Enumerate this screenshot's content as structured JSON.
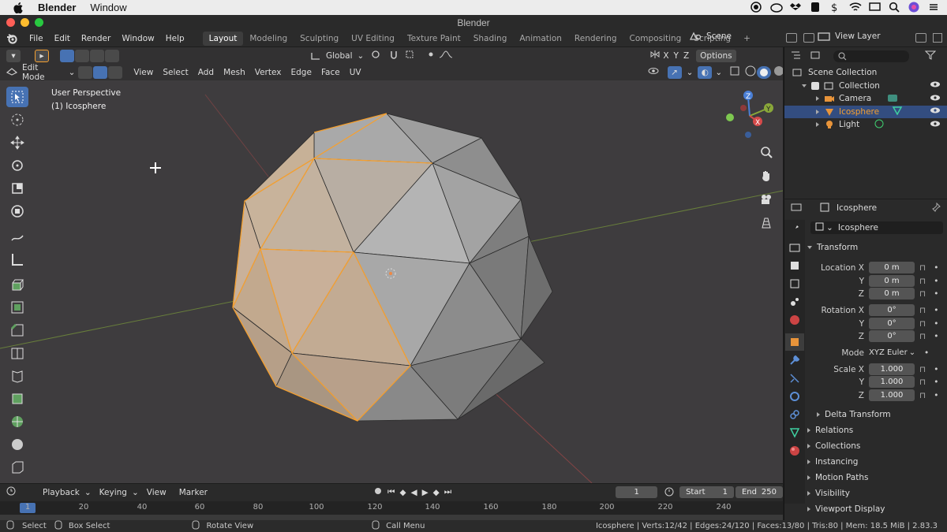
{
  "macbar": {
    "app_name": "Blender",
    "menu_window": "Window"
  },
  "window_title": "Blender",
  "topbar": {
    "menu": [
      "File",
      "Edit",
      "Render",
      "Window",
      "Help"
    ],
    "workspaces": [
      "Layout",
      "Modeling",
      "Sculpting",
      "UV Editing",
      "Texture Paint",
      "Shading",
      "Animation",
      "Rendering",
      "Compositing",
      "Scripting"
    ],
    "active_workspace": "Layout",
    "add_tab": "+",
    "scene": "Scene",
    "view_layer": "View Layer"
  },
  "viewport_header": {
    "transform_orientation": "Global",
    "mode": "Edit Mode",
    "menus": [
      "View",
      "Select",
      "Add",
      "Mesh",
      "Vertex",
      "Edge",
      "Face",
      "UV"
    ],
    "axes": [
      "X",
      "Y",
      "Z"
    ],
    "options": "Options"
  },
  "viewport": {
    "perspective": "User Perspective",
    "object_label": "(1) Icosphere"
  },
  "gizmo": {
    "x": "X",
    "y": "Y",
    "z": "Z"
  },
  "timeline": {
    "menus": [
      "Playback",
      "Keying",
      "View",
      "Marker"
    ],
    "current_frame": "1",
    "start_label": "Start",
    "start": "1",
    "end_label": "End",
    "end": "250",
    "ruler": [
      "1",
      "20",
      "40",
      "60",
      "80",
      "100",
      "120",
      "140",
      "160",
      "180",
      "200",
      "220",
      "240"
    ]
  },
  "status": {
    "select": "Select",
    "box_select": "Box Select",
    "rotate_view": "Rotate View",
    "call_menu": "Call Menu",
    "stats": "Icosphere | Verts:12/42 | Edges:24/120 | Faces:13/80 | Tris:80 | Mem: 18.5 MiB | 2.83.3"
  },
  "outliner": {
    "scene_collection": "Scene Collection",
    "collection": "Collection",
    "items": [
      "Camera",
      "Icosphere",
      "Light"
    ]
  },
  "properties": {
    "object_name": "Icosphere",
    "datablock_name": "Icosphere",
    "transform": "Transform",
    "location_label": "Location X",
    "rotation_label": "Rotation X",
    "scale_label": "Scale X",
    "y_label": "Y",
    "z_label": "Z",
    "location": [
      "0 m",
      "0 m",
      "0 m"
    ],
    "rotation": [
      "0°",
      "0°",
      "0°"
    ],
    "mode_label": "Mode",
    "mode_value": "XYZ Euler",
    "scale": [
      "1.000",
      "1.000",
      "1.000"
    ],
    "delta_transform": "Delta Transform",
    "sections": [
      "Relations",
      "Collections",
      "Instancing",
      "Motion Paths",
      "Visibility",
      "Viewport Display"
    ]
  },
  "colors": {
    "accent": "#4772b3",
    "selected": "#f5a030",
    "background": "#3e3c3e"
  }
}
